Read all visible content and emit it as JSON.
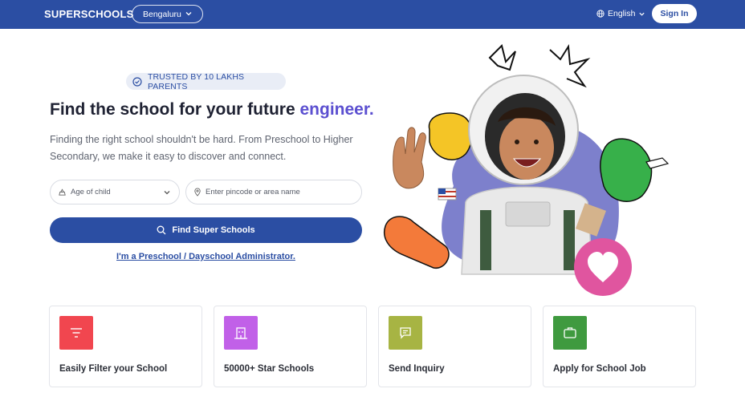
{
  "header": {
    "logo": "SUPERSCHOOLS",
    "city": "Bengaluru",
    "language": "English",
    "signin_label": "Sign In"
  },
  "hero": {
    "badge": "TRUSTED BY 10 LAKHS PARENTS",
    "title_prefix": "Find the school for your future ",
    "title_accent": "engineer.",
    "subtitle": "Finding the right school shouldn't be hard. From Preschool to Higher Secondary, we make it easy to discover and connect.",
    "age_placeholder": "Age of child",
    "pincode_placeholder": "Enter pincode or area name",
    "find_button": "Find Super Schools",
    "admin_link": "I'm a Preschool / Dayschool Administrator."
  },
  "features": [
    {
      "label": "Easily Filter your School",
      "icon": "filter-icon",
      "color": "#f1464f"
    },
    {
      "label": "50000+ Star Schools",
      "icon": "building-icon",
      "color": "#c160e8"
    },
    {
      "label": "Send Inquiry",
      "icon": "message-icon",
      "color": "#a7b443"
    },
    {
      "label": "Apply for School Job",
      "icon": "briefcase-icon",
      "color": "#3f9a3f"
    }
  ],
  "colors": {
    "brand": "#2b4ea3",
    "accent": "#5b4fd0",
    "heart": "#e0559f"
  }
}
